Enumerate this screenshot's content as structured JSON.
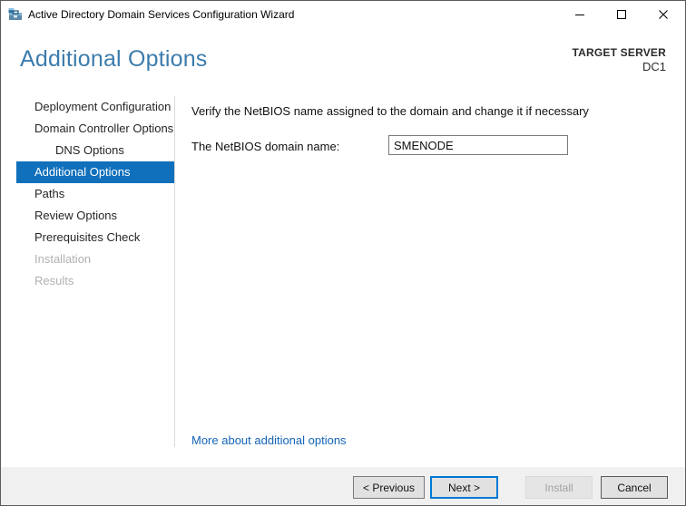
{
  "window": {
    "title": "Active Directory Domain Services Configuration Wizard"
  },
  "icons": {
    "app": "app-icon",
    "minimize": "minimize-icon",
    "maximize": "maximize-icon",
    "close": "close-icon"
  },
  "header": {
    "title": "Additional Options",
    "target_server_label": "TARGET SERVER",
    "target_server_name": "DC1"
  },
  "sidebar": {
    "items": [
      {
        "label": "Deployment Configuration",
        "state": "normal"
      },
      {
        "label": "Domain Controller Options",
        "state": "normal"
      },
      {
        "label": "DNS Options",
        "state": "normal",
        "indent": true
      },
      {
        "label": "Additional Options",
        "state": "selected"
      },
      {
        "label": "Paths",
        "state": "normal"
      },
      {
        "label": "Review Options",
        "state": "normal"
      },
      {
        "label": "Prerequisites Check",
        "state": "normal"
      },
      {
        "label": "Installation",
        "state": "disabled"
      },
      {
        "label": "Results",
        "state": "disabled"
      }
    ]
  },
  "main": {
    "description": "Verify the NetBIOS name assigned to the domain and change it if necessary",
    "netbios_label": "The NetBIOS domain name:",
    "netbios_value": "SMENODE",
    "more_link": "More about additional options"
  },
  "footer": {
    "buttons": [
      {
        "label": "< Previous",
        "state": "normal"
      },
      {
        "label": "Next >",
        "state": "default"
      },
      {
        "label": "Install",
        "state": "disabled"
      },
      {
        "label": "Cancel",
        "state": "normal"
      }
    ]
  },
  "colors": {
    "heading_blue": "#3c7cac",
    "selected_nav_bg": "#1070bc",
    "link_blue": "#1464b8",
    "default_button_border": "#0078d7",
    "footer_bg": "#f0f0f0",
    "divider": "#d9d9d9"
  }
}
